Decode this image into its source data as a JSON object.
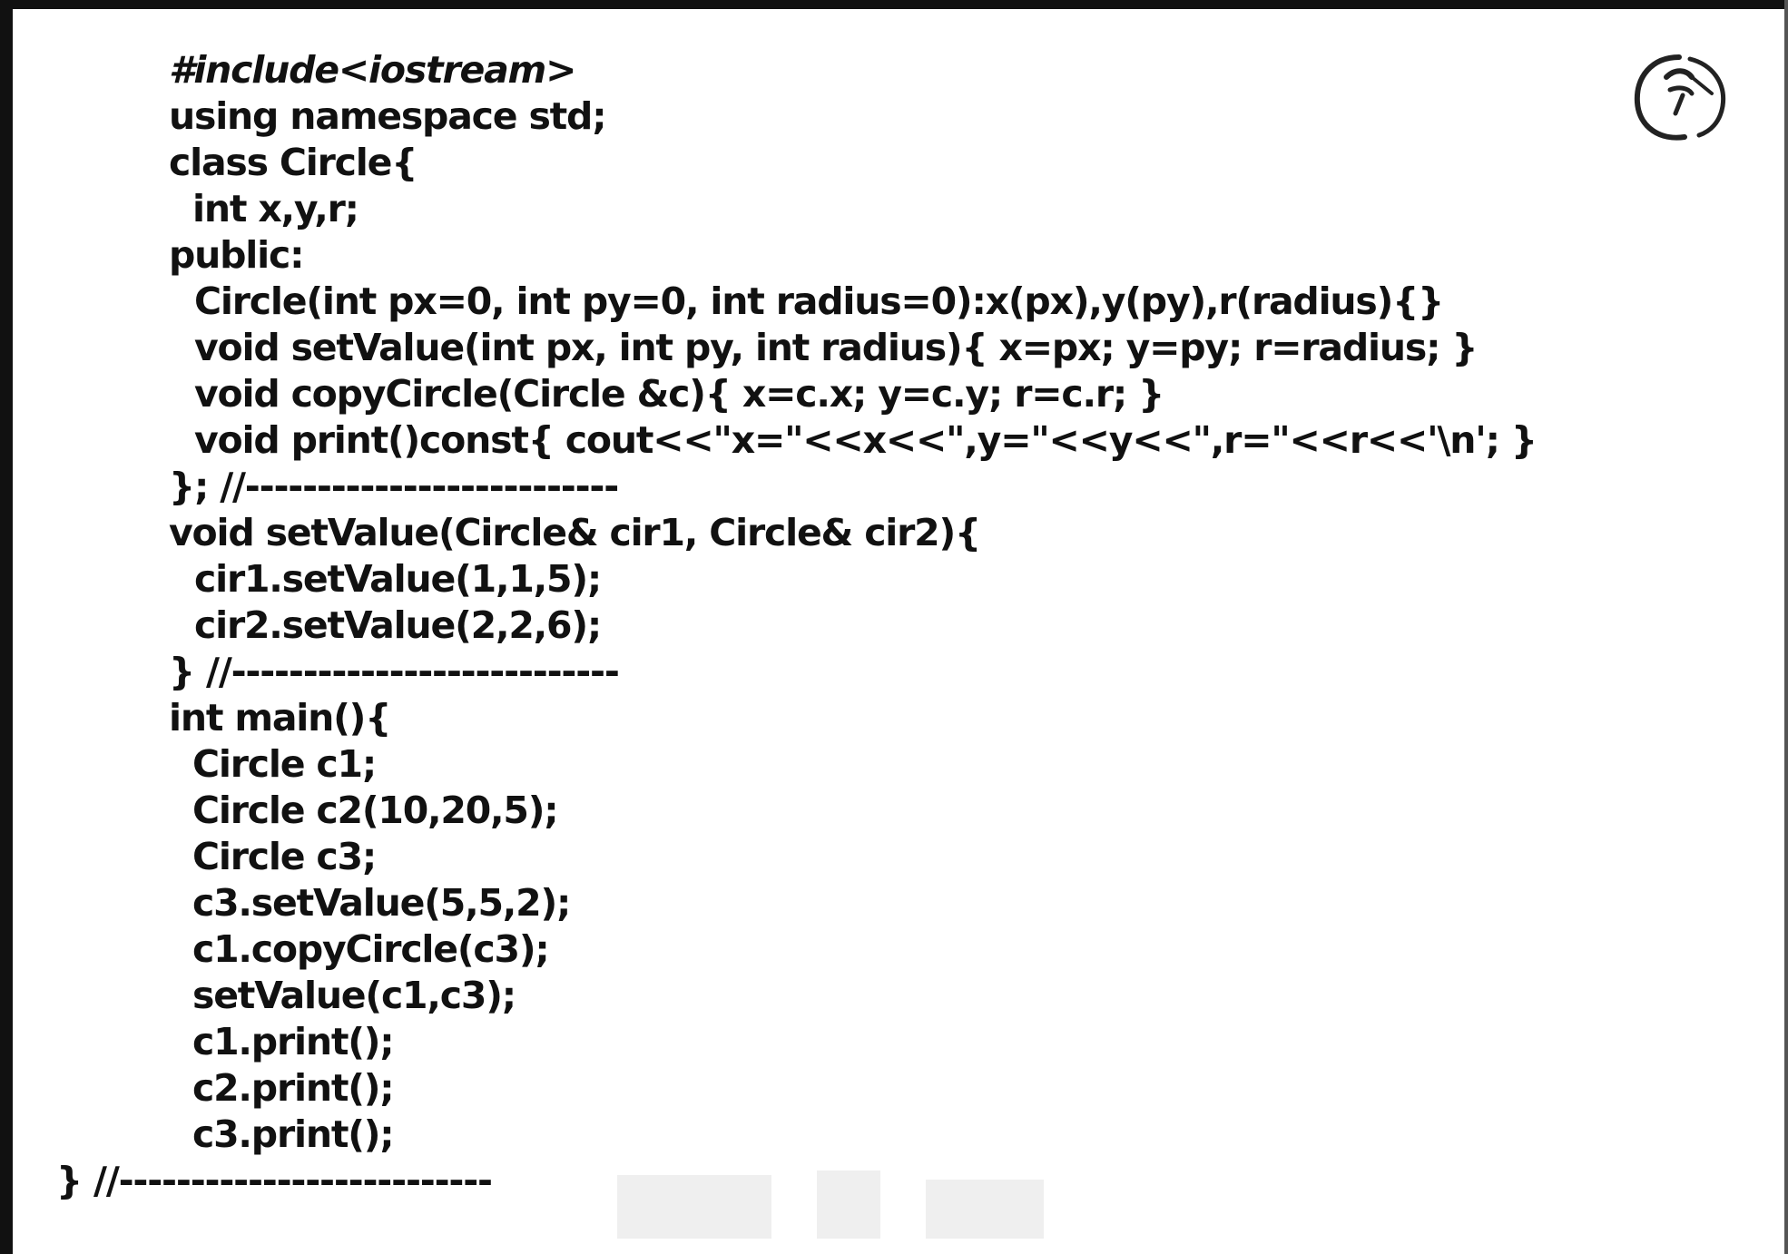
{
  "code_lines": [
    "#include<iostream>",
    "using namespace std;",
    "class Circle{",
    "int x,y,r;",
    "public:",
    "Circle(int px=0, int py=0, int radius=0):x(px),y(py),r(radius){}",
    "void setValue(int px, int py, int radius){ x=px; y=py; r=radius; }",
    "void copyCircle(Circle &c){ x=c.x; y=c.y; r=c.r; }",
    "void print()const{ cout<<\"x=\"<<x<<\",y=\"<<y<<\",r=\"<<r<<'\\n'; }",
    "}; //--------------------------",
    "void setValue(Circle& cir1, Circle& cir2){",
    "cir1.setValue(1,1,5);",
    "cir2.setValue(2,2,6);",
    "} //---------------------------",
    "int main(){",
    "Circle c1;",
    "Circle c2(10,20,5);",
    "Circle c3;",
    "c3.setValue(5,5,2);",
    "c1.copyCircle(c3);",
    "setValue(c1,c3);",
    "c1.print();",
    "c2.print();",
    "c3.print();",
    "} //--------------------------"
  ]
}
